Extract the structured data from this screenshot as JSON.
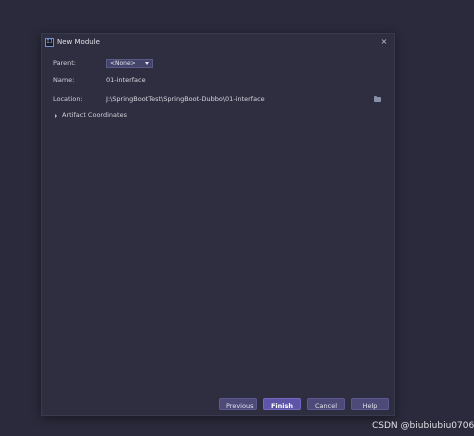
{
  "dialog": {
    "title": "New Module",
    "app_icon": "IJ",
    "close_glyph": "×"
  },
  "form": {
    "parent_label": "Parent:",
    "parent_value": "<None>",
    "name_label": "Name:",
    "name_value": "01-interface",
    "location_label": "Location:",
    "location_value": "J:\\SpringBootTest\\SpringBoot-Dubbo\\01-interface"
  },
  "section": {
    "artifact_label": "Artifact Coordinates"
  },
  "footer": {
    "previous_label": "Previous",
    "finish_label": "Finish",
    "cancel_label": "Cancel",
    "help_label": "Help"
  },
  "watermark": "CSDN @biubiubiu0706",
  "icons": {
    "app": "intellij-icon",
    "close": "close-icon",
    "folder": "folder-icon",
    "chevron": "chevron-right-icon",
    "dropdown": "chevron-down-icon"
  },
  "colors": {
    "background": "#2a2a3c",
    "dialog": "#2e2e40",
    "button": "#4d4a78",
    "primary_button": "#5e55a8",
    "select": "#44446a"
  }
}
